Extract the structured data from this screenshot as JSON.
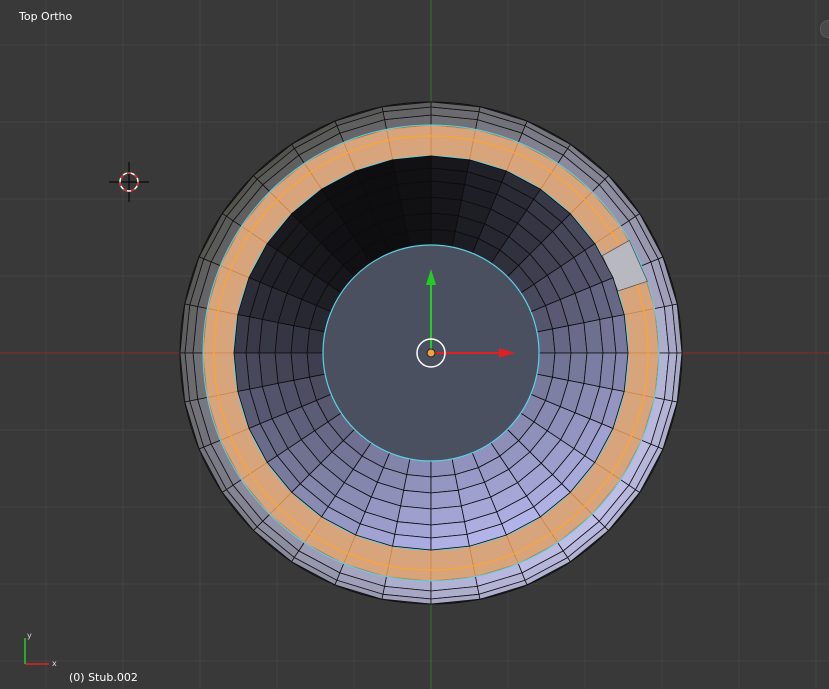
{
  "viewport": {
    "view_name": "Top Ortho",
    "object_name": "(0) Stub.002"
  },
  "axis_indicator": {
    "x_label": "x",
    "y_label": "y"
  },
  "colors": {
    "background": "#393939",
    "grid_line": "#444444",
    "x_axis": "#8a2a2a",
    "y_axis": "#2a7a2a",
    "selected_edge": "#ffa531",
    "selected_face": "#d8a47c",
    "boundary_edge": "#5ad2e6",
    "inner_face": "#4a5060",
    "manipulator_x": "#dd2222",
    "manipulator_y": "#22cc22"
  },
  "icons": [
    "3d-cursor-icon",
    "object-origin-icon",
    "transform-manipulator-icon"
  ]
}
